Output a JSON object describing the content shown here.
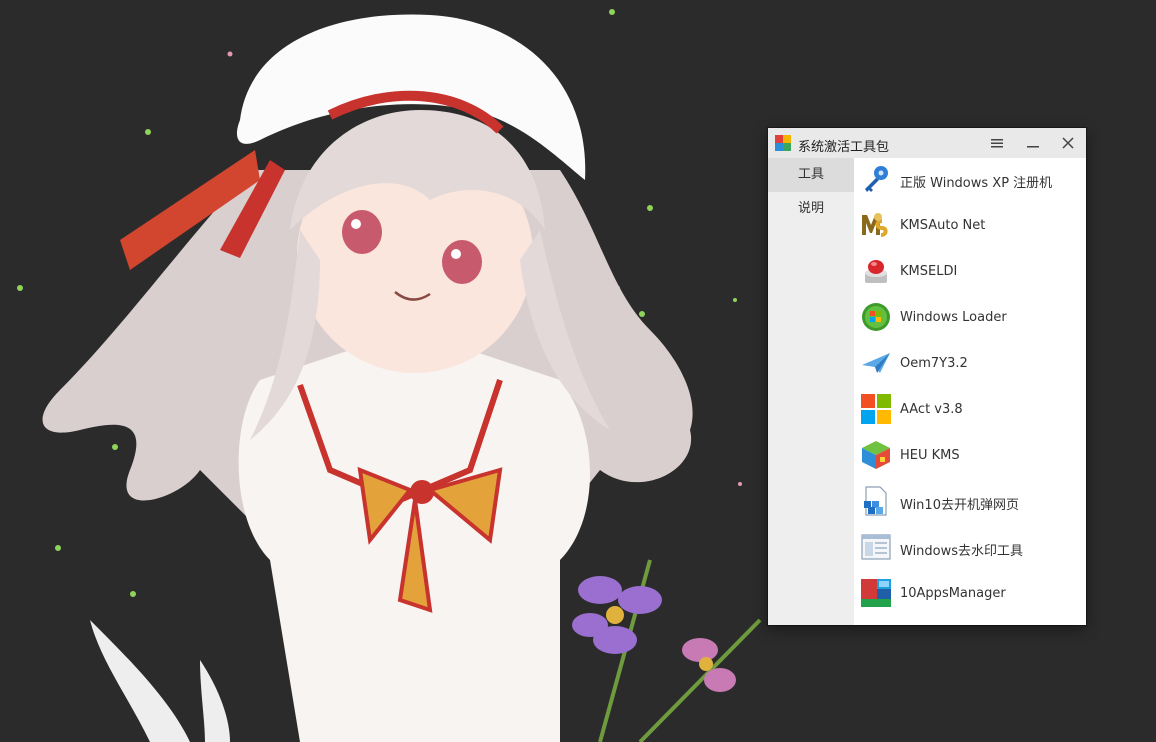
{
  "window": {
    "title": "系统激活工具包"
  },
  "sidebar": {
    "items": [
      {
        "label": "工具",
        "active": true
      },
      {
        "label": "说明",
        "active": false
      }
    ]
  },
  "tools": [
    {
      "label": "正版 Windows XP 注册机",
      "icon": "key-icon"
    },
    {
      "label": "KMSAuto Net",
      "icon": "kms-auto-icon"
    },
    {
      "label": "KMSELDI",
      "icon": "red-button-icon"
    },
    {
      "label": "Windows Loader",
      "icon": "windows-orb-icon"
    },
    {
      "label": "Oem7Y3.2",
      "icon": "paper-plane-icon"
    },
    {
      "label": "AAct v3.8",
      "icon": "windows-logo-icon"
    },
    {
      "label": "HEU KMS",
      "icon": "cube-icon"
    },
    {
      "label": "Win10去开机弹网页",
      "icon": "document-icon"
    },
    {
      "label": "Windows去水印工具",
      "icon": "window-panel-icon"
    },
    {
      "label": "10AppsManager",
      "icon": "apps-manager-icon"
    }
  ],
  "colors": {
    "titlebar": "#e9e9e9",
    "sidebar": "#eeeeee",
    "sidebar_active": "#dcdcdc",
    "desktop": "#2b2a2a"
  }
}
